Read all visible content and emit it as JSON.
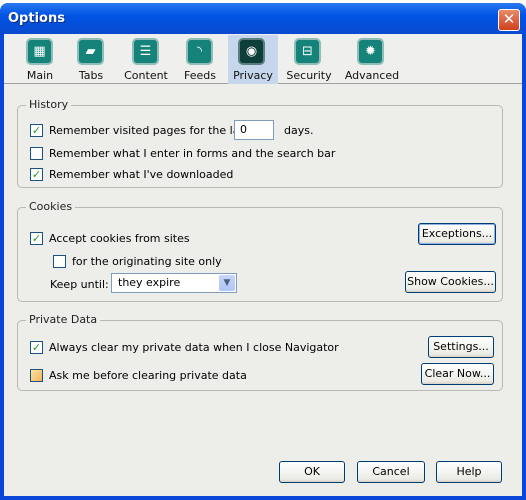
{
  "window": {
    "title": "Options",
    "close_icon": "close-icon"
  },
  "toolbar": {
    "tabs": [
      {
        "label": "Main",
        "icon": "main-grid-icon",
        "selected": false
      },
      {
        "label": "Tabs",
        "icon": "tabs-icon",
        "selected": false
      },
      {
        "label": "Content",
        "icon": "content-stack-icon",
        "selected": false
      },
      {
        "label": "Feeds",
        "icon": "rss-feed-icon",
        "selected": false
      },
      {
        "label": "Privacy",
        "icon": "eye-icon",
        "selected": true
      },
      {
        "label": "Security",
        "icon": "lock-icon",
        "selected": false
      },
      {
        "label": "Advanced",
        "icon": "gear-icon",
        "selected": false
      }
    ]
  },
  "history": {
    "title": "History",
    "remember_visited": {
      "label": "Remember visited pages for the last",
      "checked": true
    },
    "days_value": "0",
    "days_suffix": "days.",
    "remember_forms": {
      "label": "Remember what I enter in forms and the search bar",
      "checked": false
    },
    "remember_downloads": {
      "label": "Remember what I've downloaded",
      "checked": true
    }
  },
  "cookies": {
    "title": "Cookies",
    "accept": {
      "label": "Accept cookies from sites",
      "checked": true
    },
    "originating_only": {
      "label": "for the originating site only",
      "checked": false
    },
    "keep_until_label": "Keep until:",
    "keep_until_value": "they expire",
    "exceptions_button": "Exceptions...",
    "show_cookies_button": "Show Cookies..."
  },
  "private_data": {
    "title": "Private Data",
    "always_clear": {
      "label": "Always clear my private data when I close Navigator",
      "checked": true
    },
    "ask_before": {
      "label": "Ask me before clearing private data",
      "checked": false
    },
    "settings_button": "Settings...",
    "clear_now_button": "Clear Now..."
  },
  "footer": {
    "ok": "OK",
    "cancel": "Cancel",
    "help": "Help"
  },
  "colors": {
    "titlebar": "#0054e3",
    "icon_teal": "#15837a",
    "selected_tab": "#c6d6ec",
    "check": "#21a121"
  }
}
